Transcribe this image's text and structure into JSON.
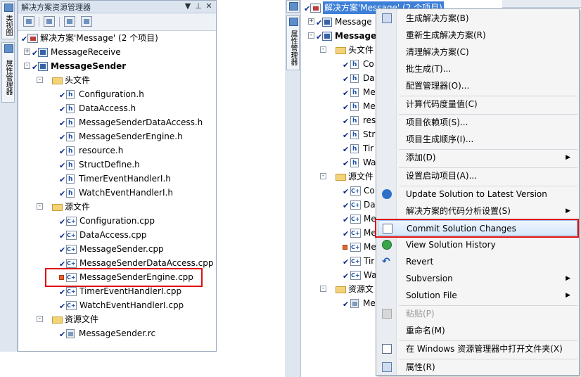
{
  "left": {
    "side_tabs": [
      "类视图",
      "属性管理器"
    ],
    "title": "解决方案资源管理器",
    "title_buttons": [
      "▼",
      "⊥",
      "✕"
    ],
    "tree": [
      {
        "label": "解决方案'Message' (2 个项目)",
        "kind": "solution",
        "level": 0
      },
      {
        "label": "MessageReceive",
        "kind": "project",
        "level": 0,
        "expander": "+"
      },
      {
        "label": "MessageSender",
        "kind": "project",
        "level": 0,
        "expander": "-",
        "bold": true
      },
      {
        "label": "头文件",
        "kind": "folder",
        "level": 1
      },
      {
        "label": "Configuration.h",
        "kind": "h",
        "level": 2
      },
      {
        "label": "DataAccess.h",
        "kind": "h",
        "level": 2
      },
      {
        "label": "MessageSenderDataAccess.h",
        "kind": "h",
        "level": 2
      },
      {
        "label": "MessageSenderEngine.h",
        "kind": "h",
        "level": 2
      },
      {
        "label": "resource.h",
        "kind": "h",
        "level": 2
      },
      {
        "label": "StructDefine.h",
        "kind": "h",
        "level": 2
      },
      {
        "label": "TimerEventHandlerI.h",
        "kind": "h",
        "level": 2
      },
      {
        "label": "WatchEventHandlerI.h",
        "kind": "h",
        "level": 2
      },
      {
        "label": "源文件",
        "kind": "folder",
        "level": 1
      },
      {
        "label": "Configuration.cpp",
        "kind": "cpp",
        "level": 2
      },
      {
        "label": "DataAccess.cpp",
        "kind": "cpp",
        "level": 2
      },
      {
        "label": "MessageSender.cpp",
        "kind": "cpp",
        "level": 2
      },
      {
        "label": "MessageSenderDataAccess.cpp",
        "kind": "cpp",
        "level": 2
      },
      {
        "label": "MessageSenderEngine.cpp",
        "kind": "cpp",
        "level": 2,
        "modified": true
      },
      {
        "label": "TimerEventHandlerI.cpp",
        "kind": "cpp",
        "level": 2
      },
      {
        "label": "WatchEventHandlerI.cpp",
        "kind": "cpp",
        "level": 2
      },
      {
        "label": "资源文件",
        "kind": "folder",
        "level": 1
      },
      {
        "label": "MessageSender.rc",
        "kind": "rc",
        "level": 2
      }
    ]
  },
  "right": {
    "side_tabs": [
      "类视图",
      "属性管理器"
    ],
    "tree": [
      {
        "label": "解决方案'Message' (2 个项目)",
        "kind": "solution",
        "selected": true
      },
      {
        "label": "Message",
        "kind": "project",
        "expander": "+"
      },
      {
        "label": "Message",
        "kind": "project",
        "expander": "-",
        "bold": true
      },
      {
        "label": "头文件",
        "kind": "folder"
      },
      {
        "label": "Co",
        "kind": "h"
      },
      {
        "label": "Da",
        "kind": "h"
      },
      {
        "label": "Me",
        "kind": "h"
      },
      {
        "label": "Me",
        "kind": "h"
      },
      {
        "label": "res",
        "kind": "h"
      },
      {
        "label": "Str",
        "kind": "h"
      },
      {
        "label": "Tir",
        "kind": "h"
      },
      {
        "label": "Wa",
        "kind": "h"
      },
      {
        "label": "源文件",
        "kind": "folder"
      },
      {
        "label": "Co",
        "kind": "cpp"
      },
      {
        "label": "Da",
        "kind": "cpp"
      },
      {
        "label": "Me",
        "kind": "cpp"
      },
      {
        "label": "Me",
        "kind": "cpp"
      },
      {
        "label": "Me",
        "kind": "cpp",
        "modified": true
      },
      {
        "label": "Tir",
        "kind": "cpp"
      },
      {
        "label": "Wa",
        "kind": "cpp"
      },
      {
        "label": "资源文",
        "kind": "folder"
      },
      {
        "label": "Me",
        "kind": "rc"
      }
    ]
  },
  "menu": [
    {
      "label": "生成解决方案(B)",
      "icon": "build-grid-icon"
    },
    {
      "label": "重新生成解决方案(R)"
    },
    {
      "label": "清理解决方案(C)"
    },
    {
      "label": "批生成(T)..."
    },
    {
      "label": "配置管理器(O)..."
    },
    {
      "separator": true
    },
    {
      "label": "计算代码度量值(C)"
    },
    {
      "separator": true
    },
    {
      "label": "项目依赖项(S)..."
    },
    {
      "label": "项目生成顺序(I)..."
    },
    {
      "separator": true
    },
    {
      "label": "添加(D)",
      "submenu": true
    },
    {
      "separator": true
    },
    {
      "label": "设置启动项目(A)..."
    },
    {
      "separator": true
    },
    {
      "label": "Update Solution to Latest Version",
      "icon": "svn-update-icon"
    },
    {
      "label": "解决方案的代码分析设置(S)",
      "submenu": true
    },
    {
      "label": "Commit Solution Changes",
      "icon": "svn-commit-icon",
      "highlighted": true
    },
    {
      "label": "View Solution History",
      "icon": "svn-history-icon"
    },
    {
      "label": "Revert",
      "icon": "undo-icon"
    },
    {
      "label": "Subversion",
      "submenu": true
    },
    {
      "label": "Solution File",
      "submenu": true
    },
    {
      "separator": true
    },
    {
      "label": "粘贴(P)",
      "icon": "paste-icon",
      "disabled": true
    },
    {
      "label": "重命名(M)"
    },
    {
      "separator": true
    },
    {
      "label": "在 Windows 资源管理器中打开文件夹(X)",
      "icon": "open-folder-icon"
    },
    {
      "separator": true
    },
    {
      "label": "属性(R)",
      "icon": "properties-icon"
    }
  ],
  "colors": {
    "highlight_border": "#e01010",
    "selection": "#3d7fd8"
  }
}
